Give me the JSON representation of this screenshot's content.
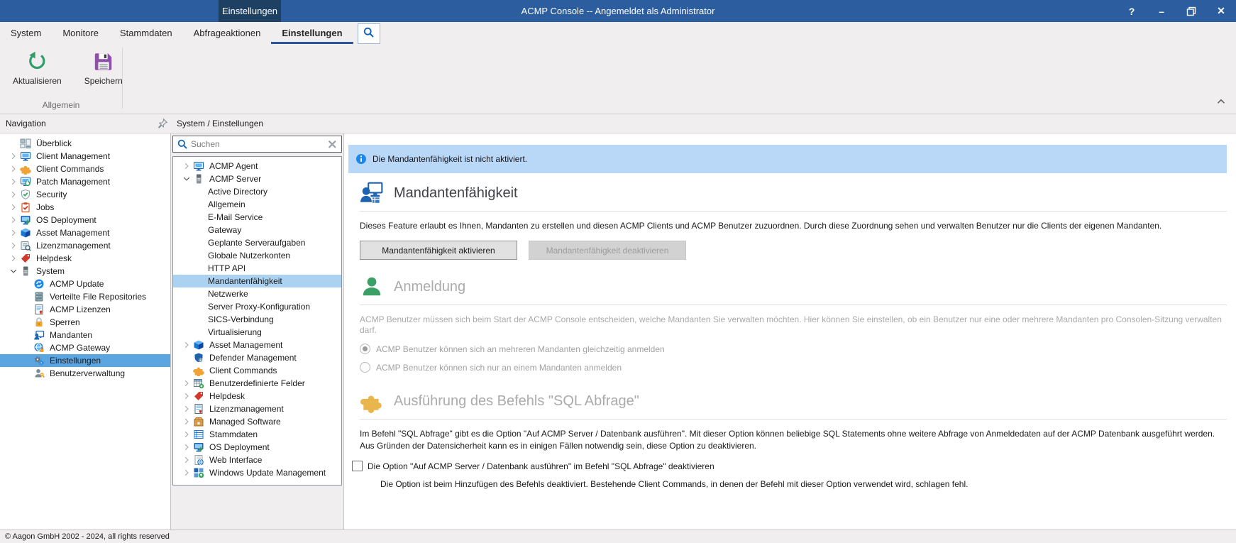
{
  "window": {
    "title": "ACMP Console -- Angemeldet als Administrator",
    "tab": "Einstellungen",
    "controls": {
      "help": "?",
      "minimize": "–",
      "restore_icon": "restore-icon",
      "close": "✕"
    }
  },
  "colors": {
    "accent": "#2b579a",
    "titlebar": "#2c5d9e",
    "titlebar_tab": "#1e4063",
    "banner_bg": "#b9d8f7",
    "nav_selection": "#5ba5e0",
    "tree_selection": "#abd3f1"
  },
  "menubar": {
    "items": [
      {
        "label": "System"
      },
      {
        "label": "Monitore"
      },
      {
        "label": "Stammdaten"
      },
      {
        "label": "Abfrageaktionen"
      },
      {
        "label": "Einstellungen",
        "active": true
      }
    ],
    "search_icon": "search-icon"
  },
  "ribbon": {
    "buttons": [
      {
        "label": "Aktualisieren",
        "icon": "refresh-large"
      },
      {
        "label": "Speichern",
        "icon": "save-large"
      }
    ],
    "group_label": "Allgemein",
    "collapse_icon": "chevron-up-icon"
  },
  "navigation": {
    "title": "Navigation",
    "pin_icon": "pin-icon",
    "items": [
      {
        "label": "Überblick",
        "icon": "overview",
        "arrow": null,
        "level": 0
      },
      {
        "label": "Client Management",
        "icon": "client-management",
        "arrow": "collapsed",
        "level": 0
      },
      {
        "label": "Client Commands",
        "icon": "client-commands",
        "arrow": "collapsed",
        "level": 0
      },
      {
        "label": "Patch Management",
        "icon": "patch-management",
        "arrow": "collapsed",
        "level": 0
      },
      {
        "label": "Security",
        "icon": "security",
        "arrow": "collapsed",
        "level": 0
      },
      {
        "label": "Jobs",
        "icon": "jobs",
        "arrow": "collapsed",
        "level": 0
      },
      {
        "label": "OS Deployment",
        "icon": "os-deployment",
        "arrow": "collapsed",
        "level": 0
      },
      {
        "label": "Asset Management",
        "icon": "asset-management",
        "arrow": "collapsed",
        "level": 0
      },
      {
        "label": "Lizenzmanagement",
        "icon": "lizenzmanagement",
        "arrow": "collapsed",
        "level": 0
      },
      {
        "label": "Helpdesk",
        "icon": "helpdesk",
        "arrow": "collapsed",
        "level": 0
      },
      {
        "label": "System",
        "icon": "system",
        "arrow": "expanded",
        "level": 0
      },
      {
        "label": "ACMP Update",
        "icon": "acmp-update",
        "arrow": null,
        "level": 1
      },
      {
        "label": "Verteilte File Repositories",
        "icon": "file-repositories",
        "arrow": null,
        "level": 1
      },
      {
        "label": "ACMP Lizenzen",
        "icon": "acmp-lizenzen",
        "arrow": null,
        "level": 1
      },
      {
        "label": "Sperren",
        "icon": "sperren",
        "arrow": null,
        "level": 1
      },
      {
        "label": "Mandanten",
        "icon": "mandanten",
        "arrow": null,
        "level": 1
      },
      {
        "label": "ACMP Gateway",
        "icon": "acmp-gateway",
        "arrow": null,
        "level": 1
      },
      {
        "label": "Einstellungen",
        "icon": "einstellungen",
        "arrow": null,
        "level": 1,
        "selected": true
      },
      {
        "label": "Benutzerverwaltung",
        "icon": "benutzerverwaltung",
        "arrow": null,
        "level": 1
      }
    ]
  },
  "settings_tree": {
    "title": "System / Einstellungen",
    "search": {
      "placeholder": "Suchen",
      "icon": "search-icon",
      "clear_icon": "clear-icon"
    },
    "items": [
      {
        "label": "ACMP Agent",
        "icon": "acmp-agent",
        "arrow": "collapsed",
        "level": 0
      },
      {
        "label": "ACMP Server",
        "icon": "acmp-server",
        "arrow": "expanded",
        "level": 0
      },
      {
        "label": "Active Directory",
        "level": 1
      },
      {
        "label": "Allgemein",
        "level": 1
      },
      {
        "label": "E-Mail Service",
        "level": 1
      },
      {
        "label": "Gateway",
        "level": 1
      },
      {
        "label": "Geplante Serveraufgaben",
        "level": 1
      },
      {
        "label": "Globale Nutzerkonten",
        "level": 1
      },
      {
        "label": "HTTP API",
        "level": 1
      },
      {
        "label": "Mandantenfähigkeit",
        "level": 1,
        "selected": true
      },
      {
        "label": "Netzwerke",
        "level": 1
      },
      {
        "label": "Server Proxy-Konfiguration",
        "level": 1
      },
      {
        "label": "SICS-Verbindung",
        "level": 1
      },
      {
        "label": "Virtualisierung",
        "level": 1
      },
      {
        "label": "Asset Management",
        "icon": "asset-management",
        "arrow": "collapsed",
        "level": 0
      },
      {
        "label": "Defender Management",
        "icon": "defender-management",
        "arrow": null,
        "level": 0
      },
      {
        "label": "Client Commands",
        "icon": "client-commands",
        "arrow": null,
        "level": 0
      },
      {
        "label": "Benutzerdefinierte Felder",
        "icon": "benutzerdefinierte-felder",
        "arrow": "collapsed",
        "level": 0
      },
      {
        "label": "Helpdesk",
        "icon": "helpdesk",
        "arrow": "collapsed",
        "level": 0
      },
      {
        "label": "Lizenzmanagement",
        "icon": "acmp-lizenzen",
        "arrow": "collapsed",
        "level": 0
      },
      {
        "label": "Managed Software",
        "icon": "managed-software",
        "arrow": "collapsed",
        "level": 0
      },
      {
        "label": "Stammdaten",
        "icon": "stammdaten",
        "arrow": "collapsed",
        "level": 0
      },
      {
        "label": "OS Deployment",
        "icon": "os-deployment",
        "arrow": "collapsed",
        "level": 0
      },
      {
        "label": "Web Interface",
        "icon": "web-interface",
        "arrow": "collapsed",
        "level": 0
      },
      {
        "label": "Windows Update Management",
        "icon": "windows-update-management",
        "arrow": "collapsed",
        "level": 0
      }
    ]
  },
  "main": {
    "banner": {
      "icon": "info-icon",
      "text": "Die Mandantenfähigkeit ist nicht aktiviert."
    },
    "feature": {
      "icon": "mandant-large",
      "title": "Mandantenfähigkeit",
      "description": "Dieses Feature erlaubt es Ihnen, Mandanten zu erstellen und diesen ACMP Clients und ACMP Benutzer zuzuordnen. Durch diese Zuordnung sehen und verwalten Benutzer nur die Clients der eigenen Mandanten.",
      "activate_button": "Mandantenfähigkeit aktivieren",
      "deactivate_button": "Mandantenfähigkeit deaktivieren"
    },
    "anmeldung": {
      "icon": "person-green",
      "title": "Anmeldung",
      "description": "ACMP Benutzer müssen sich beim Start der ACMP Console entscheiden, welche Mandanten Sie verwalten möchten. Hier können Sie einstellen, ob ein Benutzer nur eine oder mehrere Mandanten pro Consolen-Sitzung verwalten darf.",
      "options": [
        {
          "label": "ACMP Benutzer können sich an mehreren Mandanten gleichzeitig anmelden",
          "selected": true
        },
        {
          "label": "ACMP Benutzer können sich nur an einem Mandanten anmelden",
          "selected": false
        }
      ]
    },
    "sql": {
      "icon": "puzzle-large",
      "title": "Ausführung des Befehls \"SQL Abfrage\"",
      "description_line1": "Im Befehl \"SQL Abfrage\" gibt es die Option \"Auf ACMP Server / Datenbank ausführen\". Mit dieser Option können beliebige SQL Statements ohne weitere Abfrage von Anmeldedaten auf der ACMP Datenbank ausgeführt werden.",
      "description_line2": "Aus Gründen der Datensicherheit kann es in einigen Fällen notwendig sein, diese Option zu deaktivieren.",
      "checkbox_label": "Die Option \"Auf ACMP Server / Datenbank ausführen\" im Befehl \"SQL Abfrage\" deaktivieren",
      "checkbox_checked": false,
      "note": "Die Option ist beim Hinzufügen des Befehls deaktiviert. Bestehende Client Commands, in denen der Befehl mit dieser Option verwendet wird, schlagen fehl."
    }
  },
  "statusbar": {
    "text": "© Aagon GmbH 2002 - 2024, all rights reserved"
  }
}
